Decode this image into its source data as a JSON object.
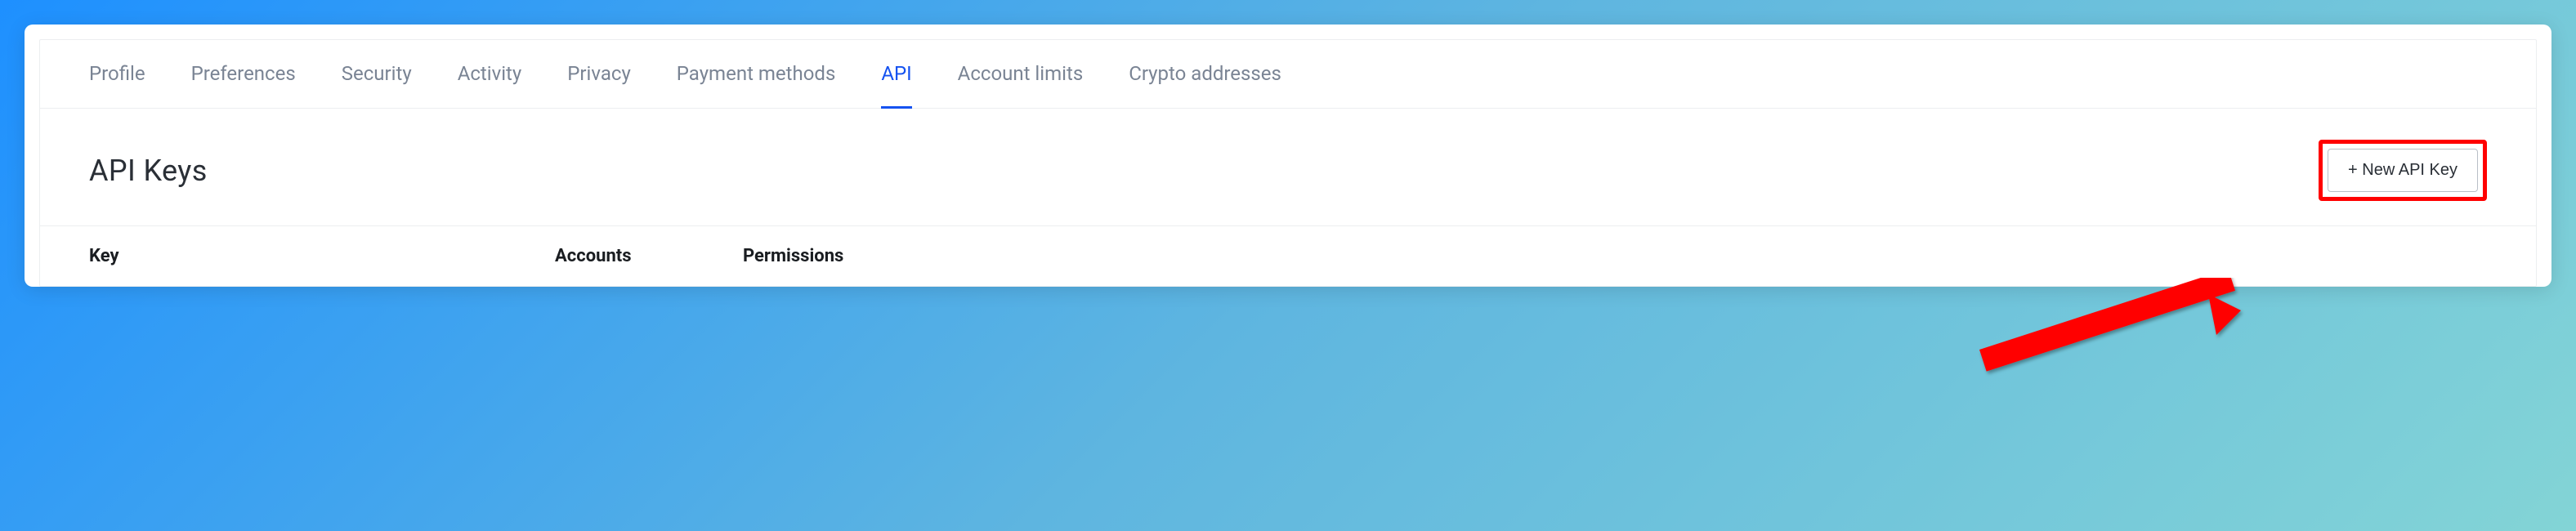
{
  "tabs": {
    "items": [
      {
        "label": "Profile",
        "active": false
      },
      {
        "label": "Preferences",
        "active": false
      },
      {
        "label": "Security",
        "active": false
      },
      {
        "label": "Activity",
        "active": false
      },
      {
        "label": "Privacy",
        "active": false
      },
      {
        "label": "Payment methods",
        "active": false
      },
      {
        "label": "API",
        "active": true
      },
      {
        "label": "Account limits",
        "active": false
      },
      {
        "label": "Crypto addresses",
        "active": false
      }
    ]
  },
  "section": {
    "title": "API Keys",
    "new_button_label": "+ New API Key"
  },
  "table": {
    "columns": {
      "key": "Key",
      "accounts": "Accounts",
      "permissions": "Permissions"
    }
  },
  "annotation": {
    "highlight_color": "#ff0000"
  }
}
